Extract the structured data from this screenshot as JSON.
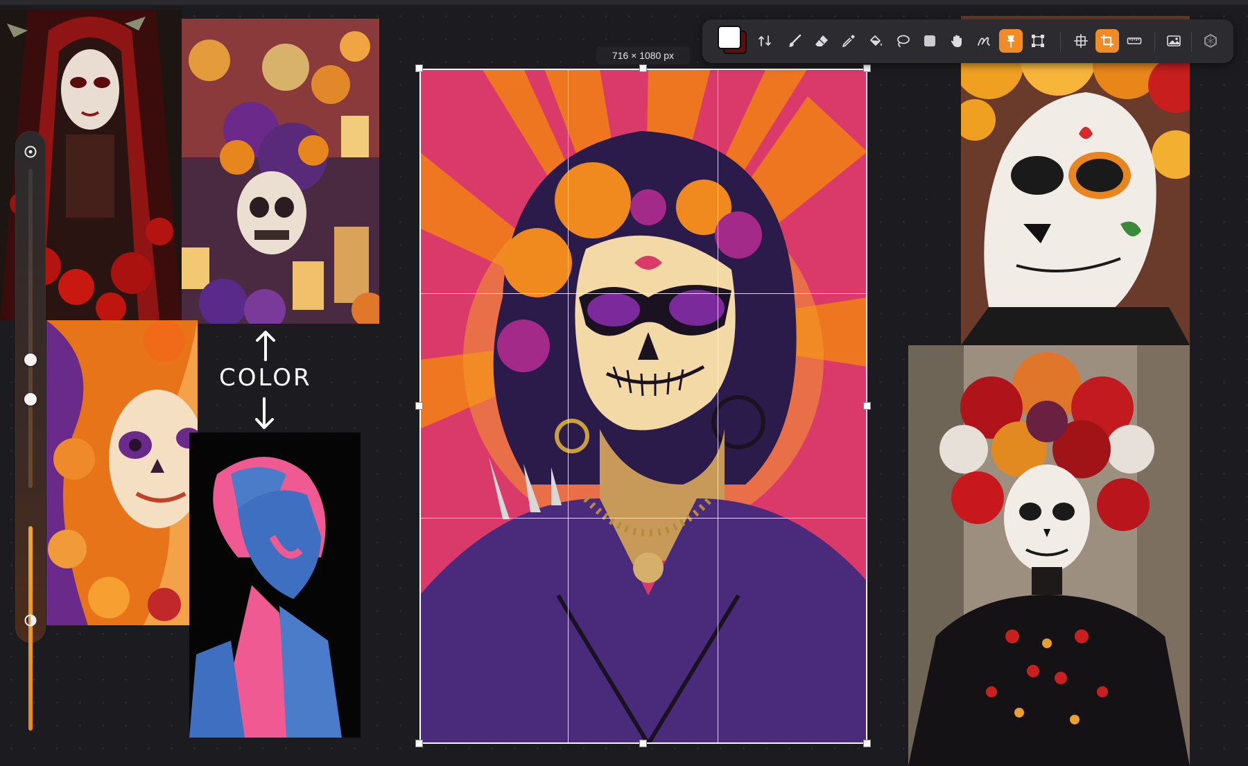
{
  "crop": {
    "dimensions_label": "716 × 1080 px"
  },
  "note": {
    "text": "COLOR"
  },
  "toolbar": {
    "tools": [
      "color-swatch",
      "swap-colors-icon",
      "brush-icon",
      "eraser-icon",
      "eyedropper-icon",
      "paint-bucket-icon",
      "lasso-icon",
      "shape-icon",
      "hand-icon",
      "smudge-icon",
      "pin-icon",
      "transform-icon",
      "crosshair-icon",
      "crop-icon",
      "ruler-icon",
      "image-icon",
      "layers-icon"
    ],
    "active_tools": [
      "pin-icon",
      "crop-icon"
    ],
    "accent_color": "#f08b25"
  },
  "slider": {
    "top_icon": "target-icon",
    "bottom_icon": "contrast-icon",
    "fill_color": "#f2a52a"
  },
  "canvas": {
    "images": [
      "hooded-sugar-skull-woman-image",
      "altar-skulls-candles-image",
      "illustrated-catrina-image",
      "pink-blue-portrait-image",
      "punk-catrina-crop-image",
      "catrina-face-paint-photo",
      "flower-crown-catrina-photo"
    ]
  }
}
